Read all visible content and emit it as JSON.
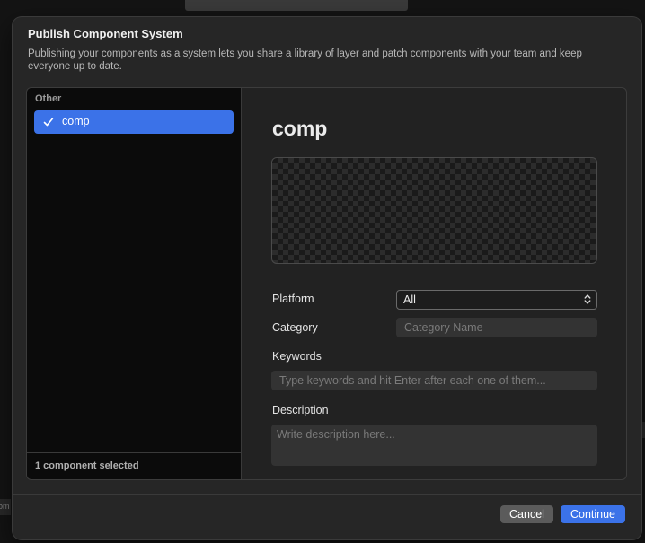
{
  "dialog": {
    "title": "Publish Component System",
    "subtitle": "Publishing your components as a system lets you share a library of layer and patch components with your team and keep everyone up to date."
  },
  "sidebar": {
    "section_label": "Other",
    "items": [
      {
        "label": "comp",
        "selected": true,
        "icon": "checkmark-icon"
      }
    ],
    "footer_text": "1 component selected"
  },
  "detail": {
    "component_name": "comp",
    "platform": {
      "label": "Platform",
      "value": "All",
      "icon": "up-down-chevron-icon"
    },
    "category": {
      "label": "Category",
      "placeholder": "Category Name",
      "value": ""
    },
    "keywords": {
      "label": "Keywords",
      "placeholder": "Type keywords and hit Enter after each one of them...",
      "value": ""
    },
    "description": {
      "label": "Description",
      "placeholder": "Write description here...",
      "value": ""
    }
  },
  "buttons": {
    "cancel": "Cancel",
    "continue": "Continue"
  },
  "background": {
    "partial_text": "om"
  },
  "colors": {
    "accent": "#3b72e8",
    "dialog_bg": "#262626",
    "sidebar_bg": "#0b0b0b",
    "cancel_bg": "#5b5b5b"
  }
}
